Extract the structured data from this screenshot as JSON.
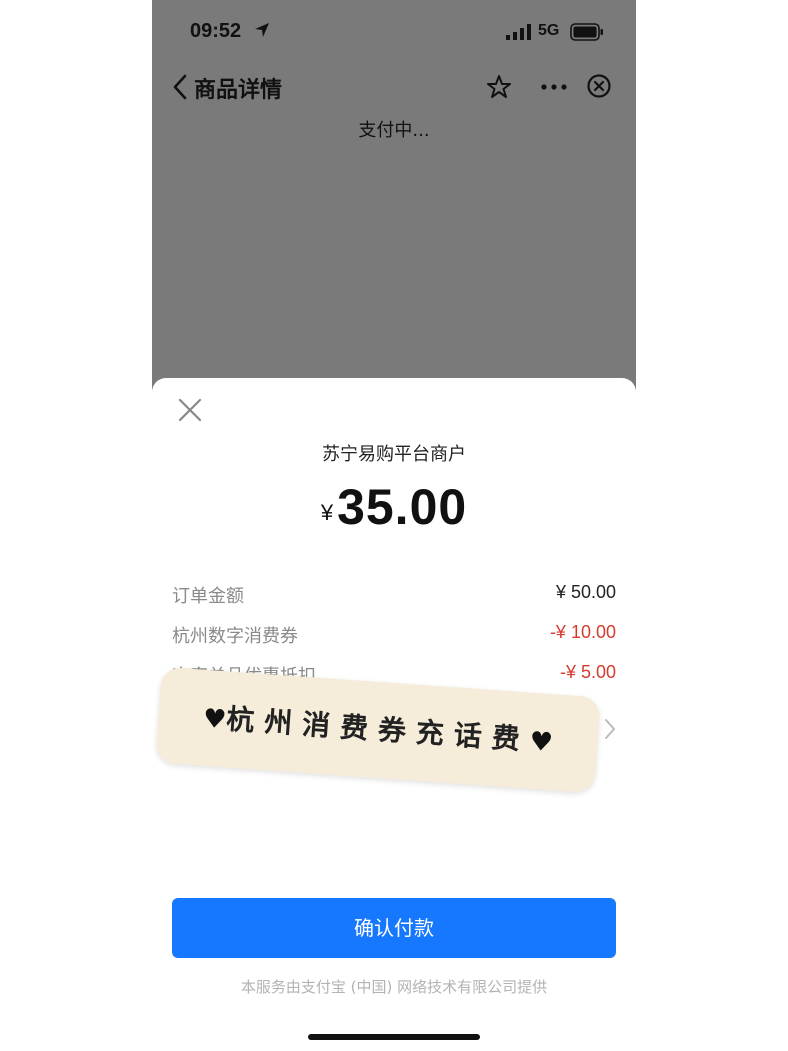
{
  "status_bar": {
    "time": "09:52",
    "network": "5G"
  },
  "nav": {
    "title": "商品详情"
  },
  "overlay": {
    "status_text": "支付中..."
  },
  "payment_sheet": {
    "merchant": "苏宁易购平台商户",
    "currency_symbol": "¥",
    "amount": "35.00",
    "rows": [
      {
        "label": "订单金额",
        "value": "¥ 50.00",
        "tone": "black"
      },
      {
        "label": "杭州数字消费券",
        "value": "-¥ 10.00",
        "tone": "red"
      },
      {
        "label": "商家单品优惠抵扣",
        "value": "-¥ 5.00",
        "tone": "red"
      }
    ],
    "sticker_text": "杭州消费券充话费",
    "confirm_button": "确认付款",
    "footer": "本服务由支付宝 (中国) 网络技术有限公司提供"
  },
  "colors": {
    "primary_button": "#1677ff",
    "discount_red": "#d43b2f",
    "overlay_gray": "#7a7a7a",
    "method_green": "#2aae67"
  }
}
